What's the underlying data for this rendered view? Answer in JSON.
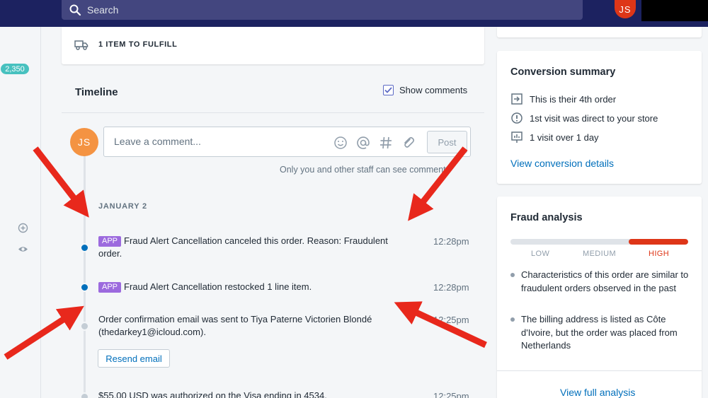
{
  "topbar": {
    "search_placeholder": "Search",
    "avatar_initials": "JS"
  },
  "left_rail": {
    "badge_count": "2,350"
  },
  "fulfill": {
    "label": "1 ITEM TO FULFILL"
  },
  "timeline": {
    "title": "Timeline",
    "show_comments_label": "Show comments",
    "show_comments_checked": true,
    "comment_avatar": "JS",
    "comment_placeholder": "Leave a comment...",
    "post_label": "Post",
    "staff_note": "Only you and other staff can see comments",
    "date_heading": "JANUARY 2",
    "events": [
      {
        "badge": "APP",
        "text": "Fraud Alert Cancellation canceled this order. Reason: Fraudulent order.",
        "time": "12:28pm"
      },
      {
        "badge": "APP",
        "text": "Fraud Alert Cancellation restocked 1 line item.",
        "time": "12:28pm"
      },
      {
        "text": "Order confirmation email was sent to Tiya Paterne Victorien Blondé (thedarkey1@icloud.com).",
        "time": "12:25pm",
        "button": "Resend email"
      },
      {
        "text": "$55.00 USD was authorized on the Visa ending in 4534.",
        "time": "12:25pm"
      }
    ]
  },
  "conversion": {
    "title": "Conversion summary",
    "rows": [
      {
        "icon": "order-history-icon",
        "text": "This is their 4th order"
      },
      {
        "icon": "first-visit-icon",
        "text": "1st visit was direct to your store"
      },
      {
        "icon": "visits-chart-icon",
        "text": "1 visit over 1 day"
      }
    ],
    "link": "View conversion details"
  },
  "fraud": {
    "title": "Fraud analysis",
    "risk_level": "high",
    "risk_labels": [
      "LOW",
      "MEDIUM",
      "HIGH"
    ],
    "bullets": [
      "Characteristics of this order are similar to fraudulent orders observed in the past",
      "The billing address is listed as Côte d'Ivoire, but the order was placed from Netherlands"
    ],
    "link": "View full analysis"
  },
  "colors": {
    "topbar": "#1c2260",
    "accent": "#5c6ac4",
    "link": "#006fbb",
    "app_badge": "#9c6ade",
    "risk_high": "#de3618",
    "annotation_arrow": "#e8281c"
  }
}
